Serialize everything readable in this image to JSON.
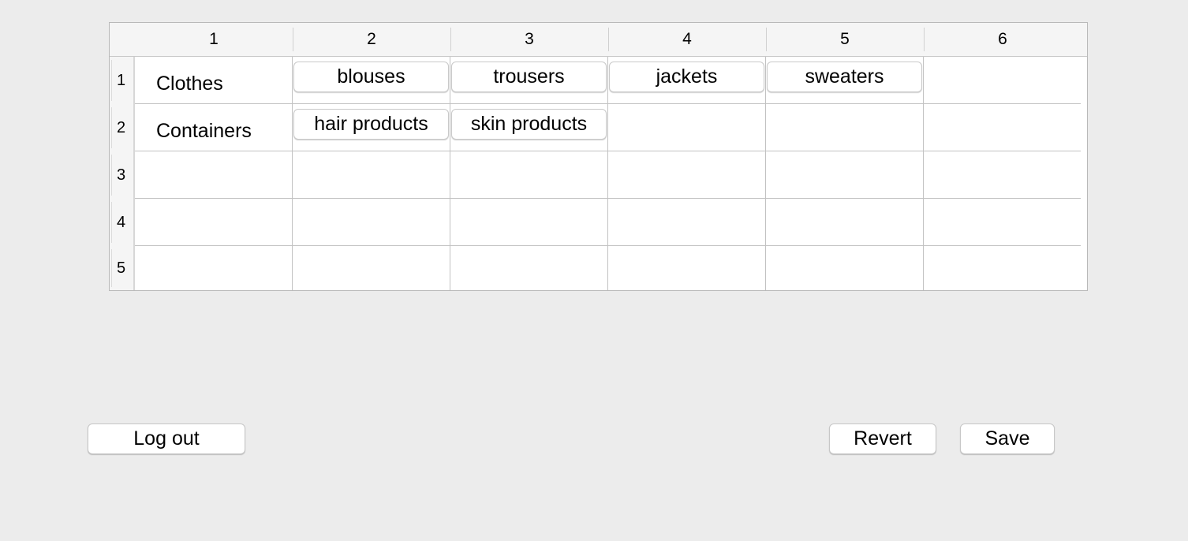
{
  "table": {
    "column_headers": [
      "1",
      "2",
      "3",
      "4",
      "5",
      "6"
    ],
    "rows": [
      {
        "header": "1",
        "label": "Clothes",
        "items": [
          "blouses",
          "trousers",
          "jackets",
          "sweaters"
        ]
      },
      {
        "header": "2",
        "label": "Containers",
        "items": [
          "hair products",
          "skin products"
        ]
      },
      {
        "header": "3",
        "label": "",
        "items": []
      },
      {
        "header": "4",
        "label": "",
        "items": []
      },
      {
        "header": "5",
        "label": "",
        "items": []
      }
    ]
  },
  "buttons": {
    "logout_label": "Log out",
    "revert_label": "Revert",
    "save_label": "Save"
  },
  "colors": {
    "window_background": "#ececec",
    "table_background": "#ffffff",
    "header_background": "#f5f5f5",
    "grid_line": "#c2c2c2"
  }
}
